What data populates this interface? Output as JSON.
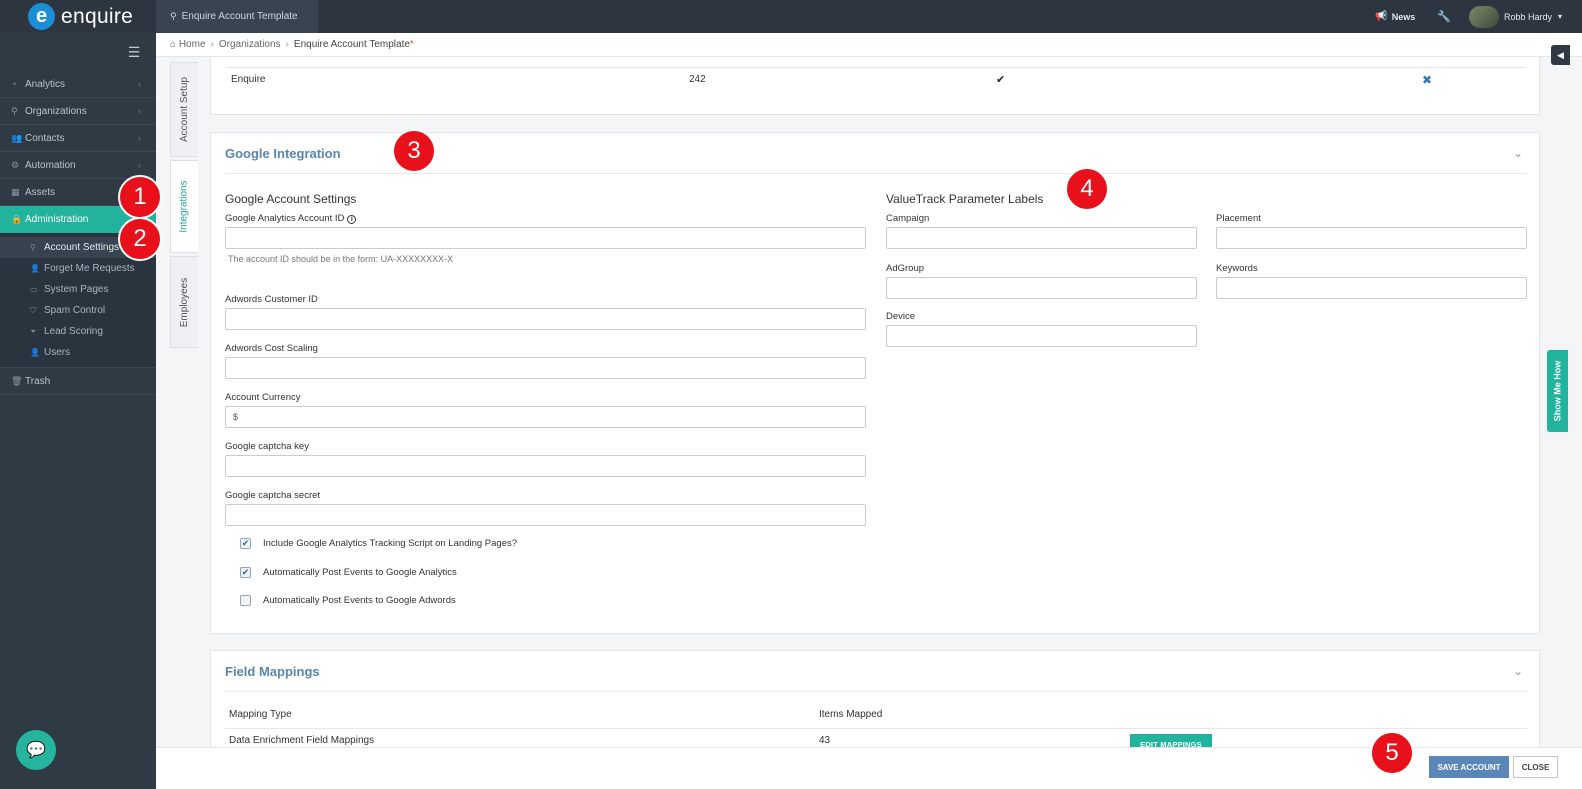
{
  "app": {
    "logo_mark": "e",
    "logo_text": "enquire",
    "top_tab": "Enquire Account Template"
  },
  "topbar": {
    "news": "News",
    "user": "Robb Hardy"
  },
  "sidebar": {
    "items": [
      {
        "label": "Analytics"
      },
      {
        "label": "Organizations"
      },
      {
        "label": "Contacts"
      },
      {
        "label": "Automation"
      },
      {
        "label": "Assets"
      },
      {
        "label": "Administration"
      }
    ],
    "sub_items": [
      {
        "label": "Account Settings"
      },
      {
        "label": "Forget Me Requests"
      },
      {
        "label": "System Pages"
      },
      {
        "label": "Spam Control"
      },
      {
        "label": "Lead Scoring"
      },
      {
        "label": "Users"
      }
    ],
    "trash": "Trash"
  },
  "breadcrumb": {
    "home": "Home",
    "orgs": "Organizations",
    "current": "Enquire Account Template",
    "star": "*"
  },
  "vtabs": {
    "account_setup": "Account Setup",
    "integrations": "Integrations",
    "employees": "Employees"
  },
  "top_table": {
    "name": "Enquire",
    "count": "242",
    "check": "✔",
    "remove": "✖"
  },
  "google": {
    "title": "Google Integration",
    "settings_heading": "Google Account Settings",
    "ga_id_label": "Google Analytics Account ID",
    "ga_hint": "The account ID should be in the form: UA-XXXXXXXX-X",
    "adwords_id_label": "Adwords Customer ID",
    "adwords_scaling_label": "Adwords Cost Scaling",
    "currency_label": "Account Currency",
    "currency_value": "$",
    "captcha_key_label": "Google captcha key",
    "captcha_secret_label": "Google captcha secret",
    "cb1": "Include Google Analytics Tracking Script on Landing Pages?",
    "cb2": "Automatically Post Events to Google Analytics",
    "cb3": "Automatically Post Events to Google Adwords",
    "valuetrack_heading": "ValueTrack Parameter Labels",
    "campaign": "Campaign",
    "placement": "Placement",
    "adgroup": "AdGroup",
    "keywords": "Keywords",
    "device": "Device"
  },
  "field_mappings": {
    "title": "Field Mappings",
    "col_type": "Mapping Type",
    "col_items": "Items Mapped",
    "row_type": "Data Enrichment Field Mappings",
    "row_items": "43",
    "edit_button": "EDIT MAPPINGS"
  },
  "footer": {
    "save": "SAVE ACCOUNT",
    "close": "CLOSE"
  },
  "show_me": "Show Me How",
  "markers": [
    "1",
    "2",
    "3",
    "4",
    "5"
  ]
}
